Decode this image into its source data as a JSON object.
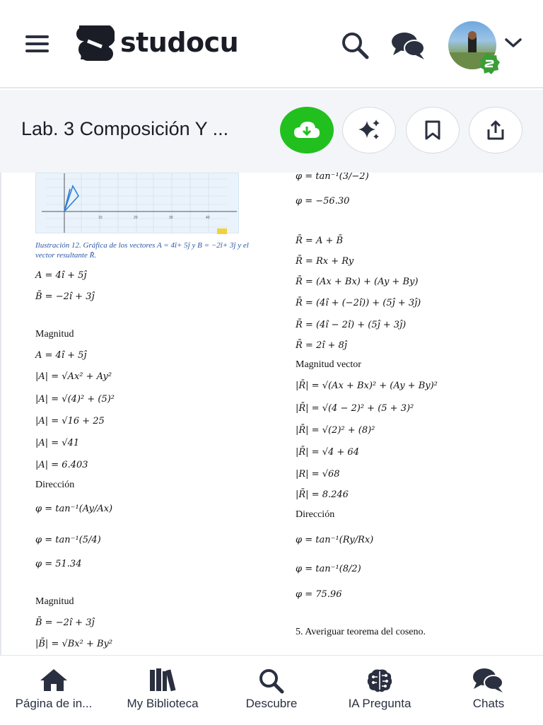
{
  "header": {
    "logo_text": "studocu",
    "icons": [
      "menu-icon",
      "search-icon",
      "chat-icon",
      "avatar",
      "chevron-down-icon"
    ]
  },
  "docbar": {
    "title": "Lab. 3 Composición Y ...",
    "actions": [
      "download-icon",
      "sparkle-icon",
      "bookmark-icon",
      "share-icon"
    ],
    "download_color": "#22c01f"
  },
  "document": {
    "caption": "Ilustración 12. Gráfica de los vectores A = 4î+ 5ĵ y B = −2î+ 3ĵ y el vector resultante R̄.",
    "left": [
      "A = 4î + 5ĵ",
      "B̄ = −2î + 3ĵ",
      "Magnitud",
      "A = 4î + 5ĵ",
      "|A| = √Ax² + Ay²",
      "|A| = √(4)² + (5)²",
      "|A| = √16 + 25",
      "|A| = √41",
      "|A| = 6.403",
      "Dirección",
      "φ = tan⁻¹(Ay/Ax)",
      "φ = tan⁻¹(5/4)",
      "φ = 51.34",
      "Magnitud",
      "B̄ = −2î + 3ĵ",
      "|B̄| = √Bx² + By²"
    ],
    "right": [
      "φ = tan⁻¹(3/−2)",
      "φ = −56.30",
      "R̄ = A + B̄",
      "R̄ = Rx + Ry",
      "R̄ = (Ax + Bx) + (Ay + By)",
      "R̄ = (4î + (−2î)) + (5ĵ + 3ĵ)",
      "R̄ = (4î − 2î) + (5ĵ + 3ĵ)",
      "R̄ = 2î + 8ĵ",
      "Magnitud vector",
      "|R̄| = √(Ax + Bx)² + (Ay + By)²",
      "|R̄| = √(4 − 2)² + (5 + 3)²",
      "|R̄| = √(2)² + (8)²",
      "|R̄| = √4 + 64",
      "|R| = √68",
      "|R̄| = 8.246",
      "Dirección",
      "φ = tan⁻¹(Ry/Rx)",
      "φ = tan⁻¹(8/2)",
      "φ = 75.96",
      "5.   Averiguar teorema del coseno."
    ],
    "axis_ticks": [
      "10",
      "20",
      "30",
      "40"
    ]
  },
  "bottomnav": {
    "items": [
      {
        "label": "Página de in...",
        "icon": "home-icon"
      },
      {
        "label": "My Biblioteca",
        "icon": "library-icon"
      },
      {
        "label": "Descubre",
        "icon": "search-icon"
      },
      {
        "label": "IA Pregunta",
        "icon": "brain-icon"
      },
      {
        "label": "Chats",
        "icon": "chat-icon"
      }
    ]
  }
}
